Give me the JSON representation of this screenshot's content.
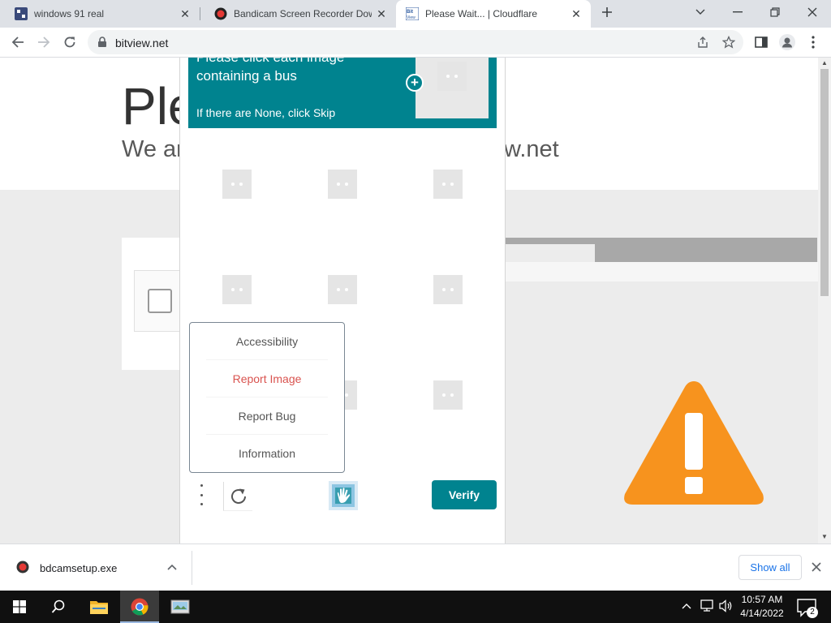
{
  "browser": {
    "tabs": [
      {
        "title": "windows 91 real",
        "favicon": "bitview-logo-icon",
        "active": false
      },
      {
        "title": "Bandicam Screen Recorder Down",
        "favicon": "bandicam-icon",
        "active": false
      },
      {
        "title": "Please Wait... | Cloudflare",
        "favicon": "bitview-logo-icon",
        "active": true
      }
    ],
    "new_tab_icon": "plus-icon",
    "address": "bitview.net",
    "toolbar_icons": [
      "back-arrow-icon",
      "forward-arrow-icon",
      "reload-icon",
      "lock-icon",
      "share-icon",
      "star-icon",
      "sidepanel-icon",
      "profile-icon",
      "kebab-menu-icon"
    ],
    "window_controls": [
      "tab-search-icon",
      "minimize-icon",
      "restore-icon",
      "close-icon"
    ]
  },
  "page": {
    "heading": "Ple",
    "subheading_left": "We ar",
    "subheading_right": "w.net",
    "colors": {
      "background": "#ececec",
      "warning": "#f7931e"
    },
    "warning_icon": "warning-triangle-icon"
  },
  "captcha": {
    "prompt_line1": "Please click each image",
    "prompt_line2": "containing a bus",
    "prompt_sub": "If there are None, click Skip",
    "accent_color": "#00838f",
    "menu_items": [
      "Accessibility",
      "Report Image",
      "Report Bug",
      "Information"
    ],
    "verify_label": "Verify",
    "icons": [
      "more-options-icon",
      "refresh-icon",
      "hcaptcha-logo-icon",
      "plus-icon"
    ]
  },
  "download_bar": {
    "filename": "bdcamsetup.exe",
    "show_all_label": "Show all"
  },
  "taskbar": {
    "time": "10:57 AM",
    "date": "4/14/2022",
    "notification_count": "2",
    "pinned": [
      "start-icon",
      "search-icon",
      "file-explorer-icon",
      "chrome-icon",
      "app-icon"
    ],
    "tray": [
      "chevron-up-icon",
      "network-icon",
      "volume-icon",
      "notification-icon"
    ]
  }
}
